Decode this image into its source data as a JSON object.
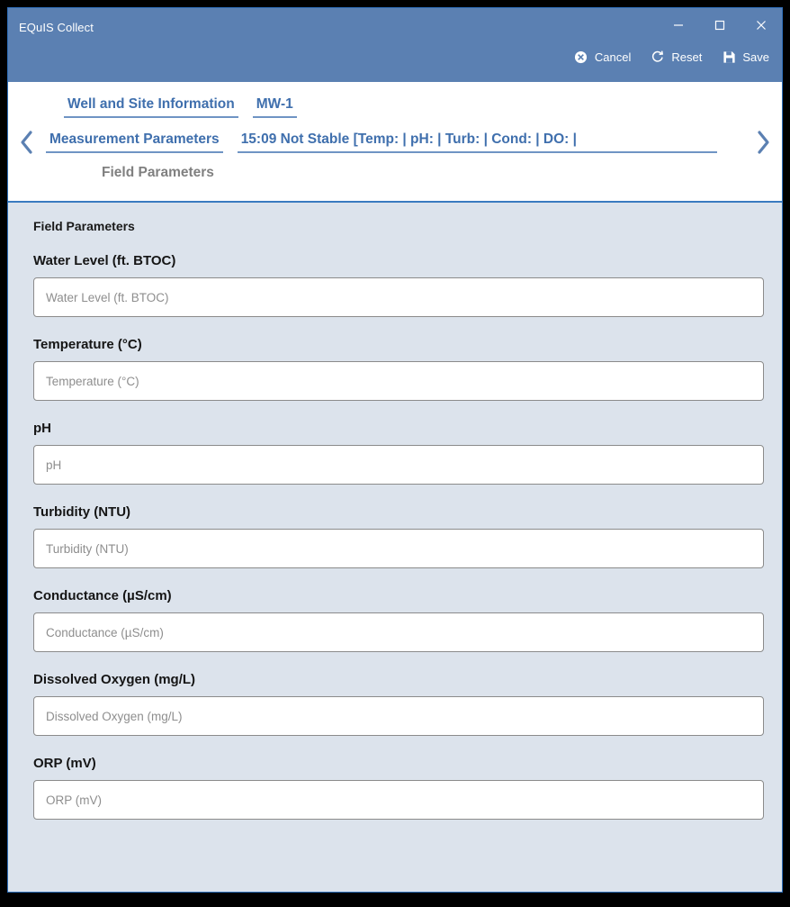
{
  "window": {
    "app_title": "EQuIS Collect",
    "controls": [
      {
        "name": "minimize",
        "glyph": "minimize-icon"
      },
      {
        "name": "maximize",
        "glyph": "maximize-icon"
      },
      {
        "name": "close",
        "glyph": "close-icon"
      }
    ],
    "accent_color": "#5b80b2",
    "content_bg": "#dce3ec",
    "border_color": "#2f6fba"
  },
  "actions": [
    {
      "label": "Cancel",
      "icon": "cancel-circle-icon"
    },
    {
      "label": "Reset",
      "icon": "refresh-icon"
    },
    {
      "label": "Save",
      "icon": "save-disk-icon"
    }
  ],
  "navigation": {
    "prev_label": "chevron-left-icon",
    "next_label": "chevron-right-icon",
    "row1": [
      {
        "label": "Well and Site Information",
        "active": true
      },
      {
        "label": "MW-1",
        "active": true
      }
    ],
    "row2": [
      {
        "label": "Measurement Parameters",
        "active": true
      },
      {
        "label": "15:09 Not Stable  [Temp:  | pH:  | Turb:  | Cond:  | DO:  |",
        "active": true
      }
    ],
    "row3": [
      {
        "label": "Field Parameters",
        "active": false
      }
    ]
  },
  "form": {
    "section_title": "Field Parameters",
    "fields": [
      {
        "label": "Water Level (ft. BTOC)",
        "placeholder": "Water Level (ft. BTOC)",
        "value": "",
        "name": "water-level"
      },
      {
        "label": "Temperature (°C)",
        "placeholder": "Temperature (°C)",
        "value": "",
        "name": "temperature"
      },
      {
        "label": "pH",
        "placeholder": "pH",
        "value": "",
        "name": "ph"
      },
      {
        "label": "Turbidity (NTU)",
        "placeholder": "Turbidity (NTU)",
        "value": "",
        "name": "turbidity"
      },
      {
        "label": "Conductance (µS/cm)",
        "placeholder": "Conductance (µS/cm)",
        "value": "",
        "name": "conductance"
      },
      {
        "label": "Dissolved Oxygen (mg/L)",
        "placeholder": "Dissolved Oxygen (mg/L)",
        "value": "",
        "name": "dissolved-oxygen"
      },
      {
        "label": "ORP (mV)",
        "placeholder": "ORP (mV)",
        "value": "",
        "name": "orp"
      }
    ]
  }
}
